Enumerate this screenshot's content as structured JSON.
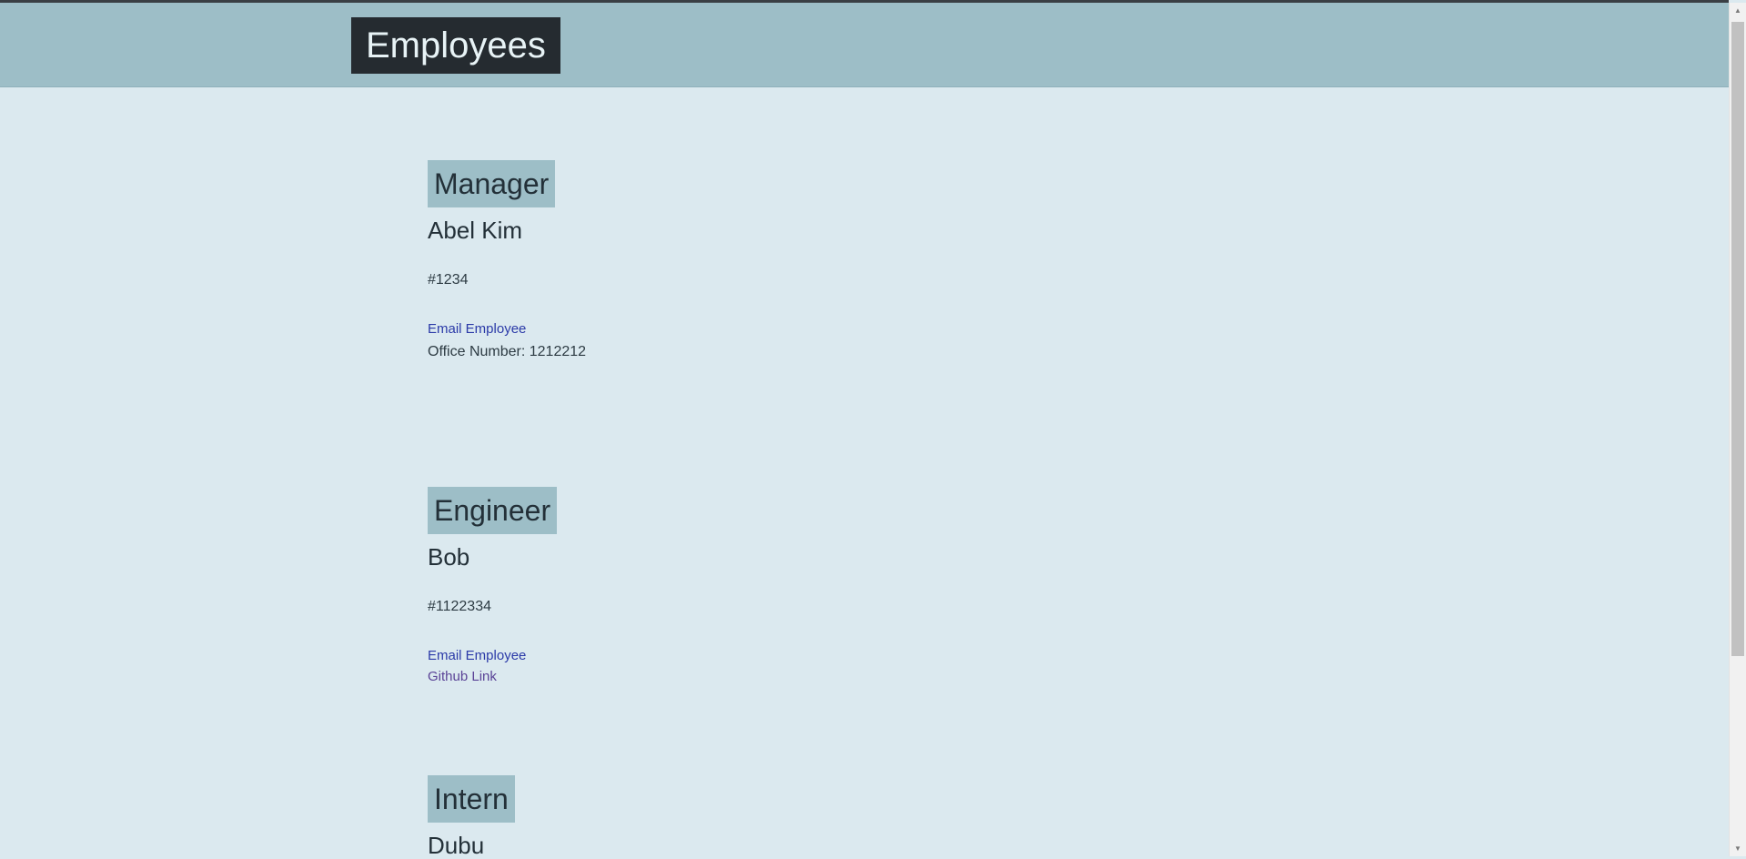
{
  "header": {
    "title": "Employees"
  },
  "employees": [
    {
      "role": "Manager",
      "name": "Abel Kim",
      "id": "#1234",
      "email_label": "Email Employee",
      "office_label": "Office Number: 1212212"
    },
    {
      "role": "Engineer",
      "name": "Bob",
      "id": "#1122334",
      "email_label": "Email Employee",
      "github_label": "Github Link"
    },
    {
      "role": "Intern",
      "name": "Dubu"
    }
  ],
  "colors": {
    "page_background": "#dbe9ef",
    "header_background": "#9dbec7",
    "title_background": "#252b30",
    "link": "#2b3aa8",
    "visited_link": "#5a4296"
  },
  "icons": {
    "scroll_up": "triangle-up-icon",
    "scroll_down": "triangle-down-icon"
  }
}
